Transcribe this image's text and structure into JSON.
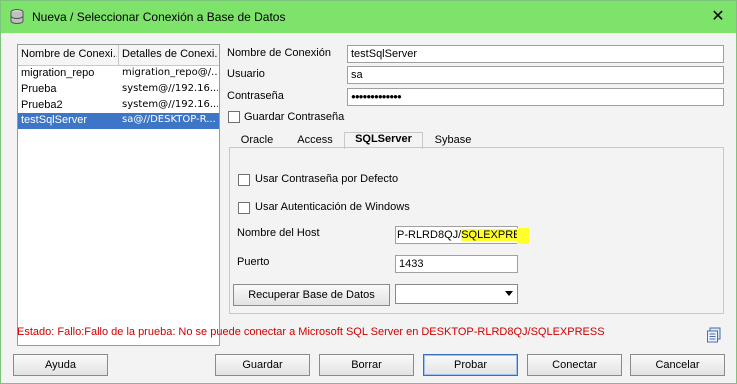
{
  "window": {
    "title": "Nueva / Seleccionar Conexión a Base de Datos",
    "close_glyph": "✕"
  },
  "connections": {
    "headers": [
      "Nombre de Conexi...",
      "Detalles de Conexi..."
    ],
    "rows": [
      {
        "name": "migration_repo",
        "details": "migration_repo@/..."
      },
      {
        "name": "Prueba",
        "details": "system@//192.16..."
      },
      {
        "name": "Prueba2",
        "details": "system@//192.16..."
      },
      {
        "name": "testSqlServer",
        "details": "sa@//DESKTOP-R..."
      }
    ]
  },
  "form": {
    "nombre_label": "Nombre de Conexión",
    "nombre_value": "testSqlServer",
    "usuario_label": "Usuario",
    "usuario_value": "sa",
    "contrasena_label": "Contraseña",
    "contrasena_value": "●●●●●●●●●●●●●",
    "guardar_pwd_label": "Guardar Contraseña"
  },
  "tabs": [
    "Oracle",
    "Access",
    "SQLServer",
    "Sybase"
  ],
  "sqlserver": {
    "default_pwd_label": "Usar Contraseña por Defecto",
    "windows_auth_label": "Usar Autenticación de Windows",
    "host_label": "Nombre del Host",
    "host_value_prefix": "P-RLRD8QJ/",
    "host_value_highlight": "SQLEXPRESS",
    "port_label": "Puerto",
    "port_value": "1433",
    "recover_db_label": "Recuperar Base de Datos"
  },
  "status": "Estado: Fallo:Fallo de la prueba: No se puede conectar a Microsoft SQL Server en DESKTOP-RLRD8QJ/SQLEXPRESS",
  "buttons": {
    "help": "Ayuda",
    "save": "Guardar",
    "delete": "Borrar",
    "test": "Probar",
    "connect": "Conectar",
    "cancel": "Cancelar"
  },
  "colors": {
    "titlebar": "#7de36b",
    "selection": "#3d76c6",
    "status": "#d00000",
    "highlight": "#ffff2a"
  }
}
